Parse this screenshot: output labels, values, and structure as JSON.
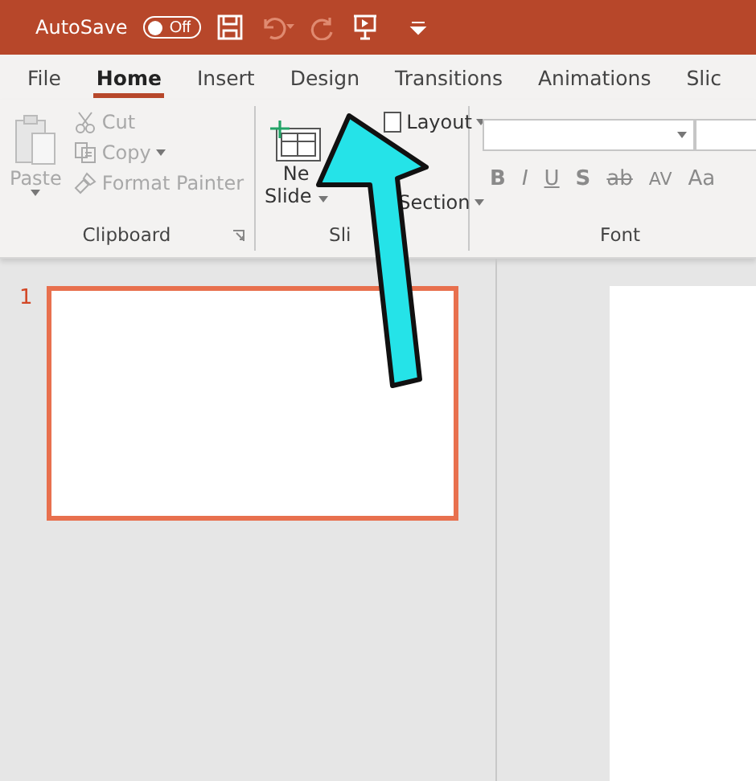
{
  "title_bar": {
    "autosave_label": "AutoSave",
    "autosave_toggle": {
      "label": "Off",
      "on": false
    }
  },
  "tabs": [
    {
      "label": "File",
      "selected": false
    },
    {
      "label": "Home",
      "selected": true
    },
    {
      "label": "Insert",
      "selected": false
    },
    {
      "label": "Design",
      "selected": false
    },
    {
      "label": "Transitions",
      "selected": false
    },
    {
      "label": "Animations",
      "selected": false
    },
    {
      "label": "Slic",
      "selected": false
    }
  ],
  "clipboard": {
    "paste": {
      "label": "Paste",
      "disabled": true
    },
    "items": [
      {
        "label": "Cut",
        "disabled": true
      },
      {
        "label": "Copy",
        "disabled": true
      },
      {
        "label": "Format Painter",
        "disabled": true
      }
    ],
    "group_label": "Clipboard"
  },
  "slides_group": {
    "new_slide": [
      "Ne",
      "Slide"
    ],
    "items": [
      "Layout",
      "Section"
    ],
    "group_label": "Sli"
  },
  "font_group": {
    "format_buttons": [
      "B",
      "I",
      "U",
      "S",
      "ab",
      "AV",
      "Aa"
    ],
    "group_label": "Font"
  },
  "slides_pane": {
    "thumbnails": [
      {
        "number": "1",
        "selected": true
      }
    ]
  }
}
